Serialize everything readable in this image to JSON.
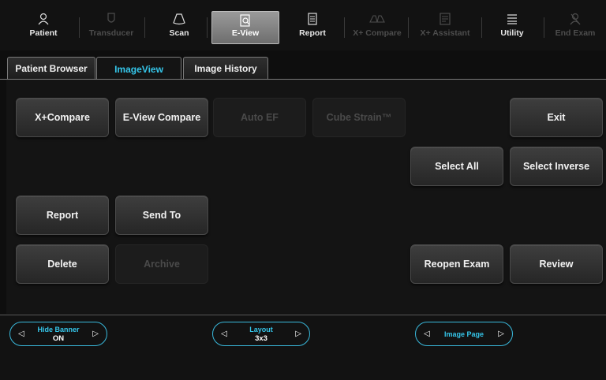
{
  "toolbar": {
    "items": [
      {
        "label": "Patient",
        "icon": "patient-icon",
        "state": "enabled"
      },
      {
        "label": "Transducer",
        "icon": "transducer-icon",
        "state": "disabled"
      },
      {
        "label": "Scan",
        "icon": "scan-icon",
        "state": "enabled"
      },
      {
        "label": "E-View",
        "icon": "e-view-icon",
        "state": "active"
      },
      {
        "label": "Report",
        "icon": "report-icon",
        "state": "enabled"
      },
      {
        "label": "X+ Compare",
        "icon": "x-compare-icon",
        "state": "disabled"
      },
      {
        "label": "X+ Assistant",
        "icon": "x-assistant-icon",
        "state": "disabled"
      },
      {
        "label": "Utility",
        "icon": "utility-icon",
        "state": "enabled"
      },
      {
        "label": "End Exam",
        "icon": "end-exam-icon",
        "state": "disabled"
      }
    ]
  },
  "tabs": [
    {
      "label": "Patient Browser",
      "active": false
    },
    {
      "label": "ImageView",
      "active": true
    },
    {
      "label": "Image History",
      "active": false
    }
  ],
  "buttons": {
    "x_compare": "X+Compare",
    "e_view_compare": "E-View Compare",
    "auto_ef": "Auto EF",
    "cube_strain": "Cube Strain™",
    "exit": "Exit",
    "select_all": "Select All",
    "select_inverse": "Select Inverse",
    "report": "Report",
    "send_to": "Send To",
    "delete": "Delete",
    "archive": "Archive",
    "reopen_exam": "Reopen Exam",
    "review": "Review"
  },
  "bottom": {
    "hide_banner": {
      "label": "Hide Banner",
      "value": "ON"
    },
    "layout": {
      "label": "Layout",
      "value": "3x3"
    },
    "image_page": {
      "label": "Image Page"
    }
  },
  "colors": {
    "accent": "#35c6ea",
    "background": "#0e0e0e"
  }
}
